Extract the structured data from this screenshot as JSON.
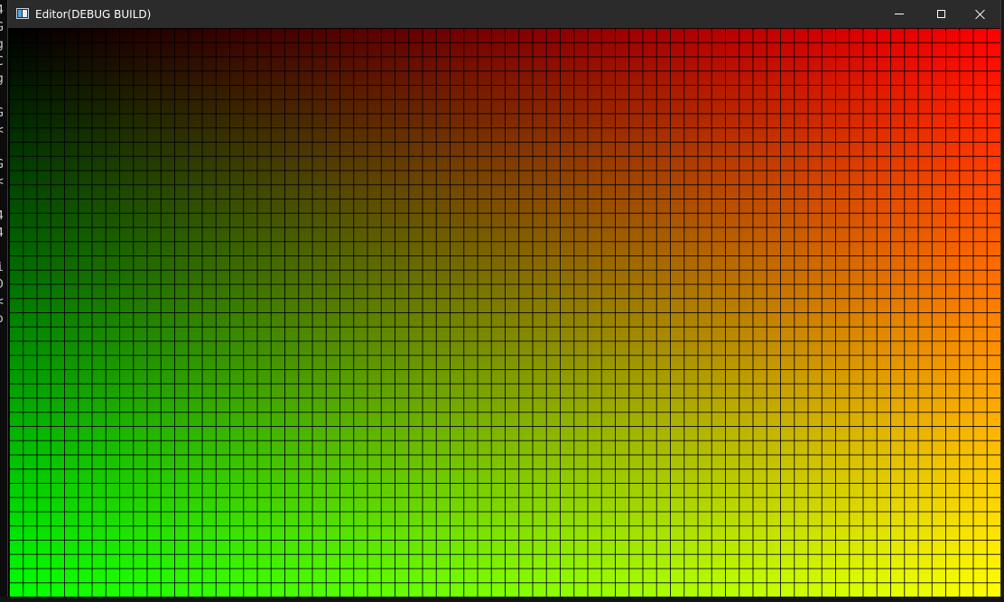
{
  "window": {
    "title": "Editor(DEBUG BUILD)",
    "icon": "application-window-icon",
    "controls": {
      "minimize_icon": "minimize-icon",
      "maximize_icon": "maximize-icon",
      "close_icon": "close-icon"
    }
  },
  "viewport": {
    "grid_columns": 72,
    "grid_rows": 40,
    "colors": {
      "top_left": "#000000",
      "top_right": "#ff0000",
      "bottom_left": "#00ff00",
      "bottom_right": "#ffff00",
      "grid_line": "#000000"
    }
  },
  "background_terminal": {
    "glyphs": [
      "4",
      "G",
      "g",
      "C",
      "g",
      "",
      "G",
      "<",
      "",
      "G",
      "<",
      "",
      "4",
      "4",
      "",
      "i",
      "D",
      "<",
      "o"
    ]
  }
}
